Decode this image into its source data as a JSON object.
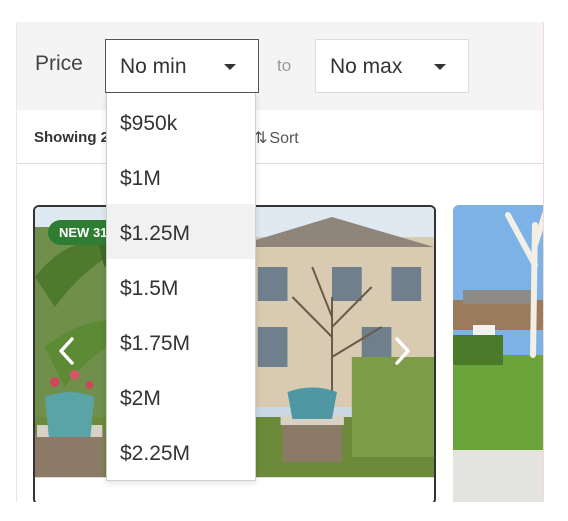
{
  "filter": {
    "price_label": "Price",
    "min_selected": "No min",
    "to_label": "to",
    "max_selected": "No max",
    "min_options": [
      "$950k",
      "$1M",
      "$1.25M",
      "$1.5M",
      "$1.75M",
      "$2M",
      "$2.25M"
    ],
    "highlighted_option": "$1.25M"
  },
  "results": {
    "showing_text": "Showing 2",
    "sort_label": "Sort"
  },
  "listing": {
    "badge": "NEW 31"
  },
  "icons": {
    "min_caret": "caret-down-icon",
    "max_caret": "caret-down-icon",
    "sort": "sort-arrows-icon",
    "prev": "chevron-left-icon",
    "next": "chevron-right-icon"
  },
  "colors": {
    "badge_bg": "#2e7d32",
    "filter_bar_bg": "#f4f4f4",
    "highlight_bg": "#f1f1f1"
  }
}
